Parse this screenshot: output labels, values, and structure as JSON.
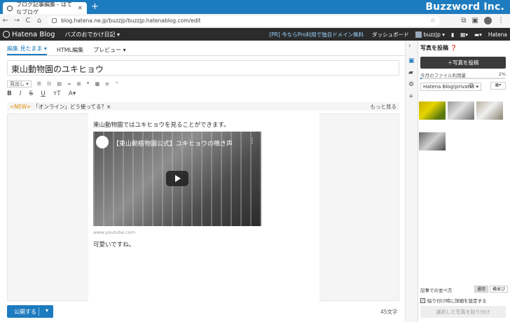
{
  "browser": {
    "tab_title": "ブログ記事編集 - はてなブログ",
    "tab_close": "×",
    "new_tab": "+",
    "url": "blog.hatena.ne.jp/buzzjp/buzzjp.hatenablog.com/edit",
    "watermark": "Buzzword Inc.",
    "nav_icons": [
      "←",
      "→",
      "C",
      "⌂"
    ]
  },
  "header": {
    "logo": "Hatena Blog",
    "blog_name": "バズのおでかけ日記 ▾",
    "promo": "[PR] 今ならPro利用で独自ドメイン無料",
    "dashboard": "ダッシュボード",
    "user": "buzzjp ▾",
    "brand": "Hatena"
  },
  "editor": {
    "tabs": [
      {
        "label": "編集 見たまま ▾",
        "active": true
      },
      {
        "label": "HTML編集",
        "active": false
      },
      {
        "label": "プレビュー ▾",
        "active": false
      }
    ],
    "title": "東山動物園のユキヒョウ",
    "heading_select": "見出し ▾",
    "news_badge": "<NEW>",
    "news_text": "「オンライン」どう使ってる？×",
    "news_more": "もっと見る",
    "paragraph1": "東山動物園ではユキヒョウを見ることができます。",
    "video_title": "【東山動植物園公式】ユキヒョウの鳴き声",
    "video_source": "www.youtube.com",
    "paragraph2": "可愛いですね。",
    "publish_label": "公開する",
    "char_count": "45文字"
  },
  "sidebar": {
    "title": "写真を投稿 ❓",
    "upload_button": "＋写真を投稿",
    "quota_label": "今月のファイル利用量",
    "quota_value": "2%",
    "quota_fraction": 0.02,
    "album": "Hatena Blog(private) ▾",
    "arrange_label": "記事での並べ方",
    "arrange_options": [
      "通常",
      "横並び"
    ],
    "detail_checkbox_label": "貼り付け時に詳細を設定する",
    "detail_checked": true,
    "paste_button": "選択した写真を貼り付け"
  }
}
